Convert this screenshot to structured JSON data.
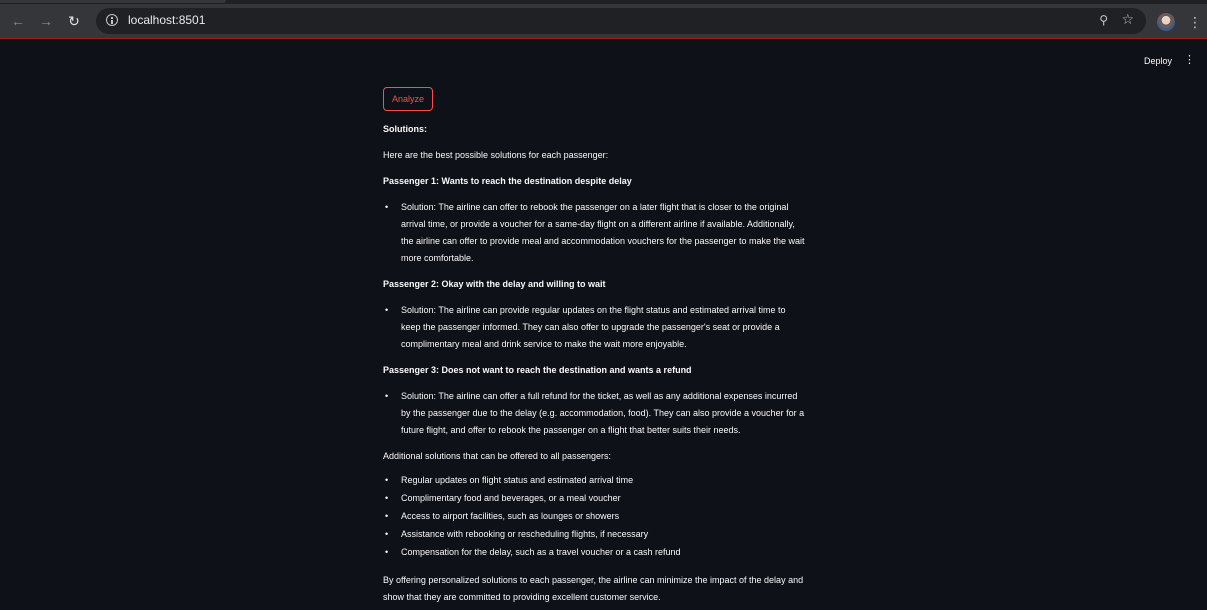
{
  "browser": {
    "url": "localhost:8501"
  },
  "app": {
    "deploy_label": "Deploy",
    "analyze_label": "Analyze",
    "solutions_heading": "Solutions:",
    "intro": "Here are the best possible solutions for each passenger:",
    "passengers": [
      {
        "heading": "Passenger 1: Wants to reach the destination despite delay",
        "lines": [
          "Solution: The airline can offer to rebook the passenger on a later flight that is closer to the original",
          "arrival time, or provide a voucher for a same-day flight on a different airline if available. Additionally,",
          "the airline can offer to provide meal and accommodation vouchers for the passenger to make the wait",
          "more comfortable."
        ]
      },
      {
        "heading": "Passenger 2: Okay with the delay and willing to wait",
        "lines": [
          "Solution: The airline can provide regular updates on the flight status and estimated arrival time to",
          "keep the passenger informed. They can also offer to upgrade the passenger's seat or provide a",
          "complimentary meal and drink service to make the wait more enjoyable."
        ]
      },
      {
        "heading": "Passenger 3: Does not want to reach the destination and wants a refund",
        "lines": [
          "Solution: The airline can offer a full refund for the ticket, as well as any additional expenses incurred",
          "by the passenger due to the delay (e.g. accommodation, food). They can also provide a voucher for a",
          "future flight, and offer to rebook the passenger on a flight that better suits their needs."
        ]
      }
    ],
    "additional_heading": "Additional solutions that can be offered to all passengers:",
    "additional_items": [
      "Regular updates on flight status and estimated arrival time",
      "Complimentary food and beverages, or a meal voucher",
      "Access to airport facilities, such as lounges or showers",
      "Assistance with rebooking or rescheduling flights, if necessary",
      "Compensation for the delay, such as a travel voucher or a cash refund"
    ],
    "closing_lines": [
      "By offering personalized solutions to each passenger, the airline can minimize the impact of the delay and",
      "show that they are committed to providing excellent customer service."
    ]
  },
  "colors": {
    "background": "#0e1117",
    "text": "#fafafa",
    "accent": "#ff4b4b",
    "chrome": "#35363a"
  }
}
